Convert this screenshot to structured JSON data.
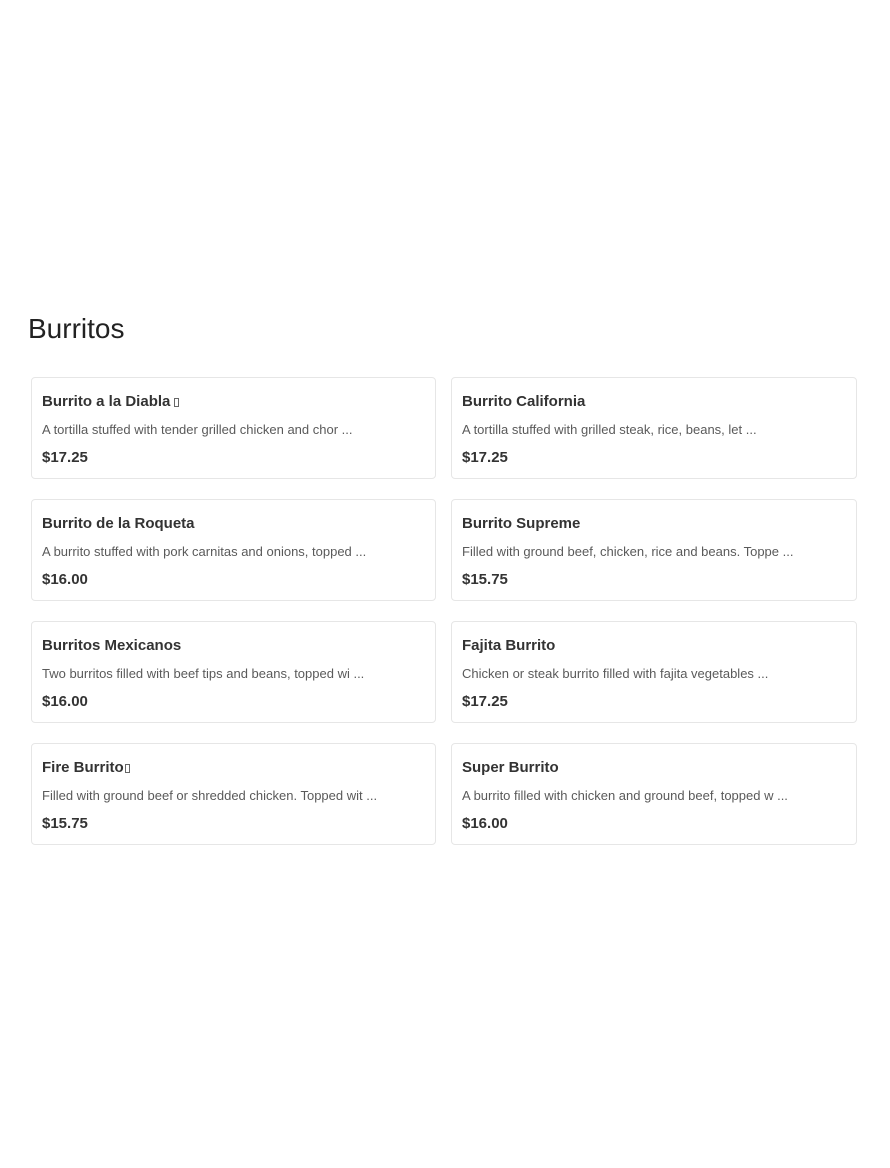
{
  "section": {
    "title": "Burritos"
  },
  "items": [
    {
      "name": "Burrito a la Diabla",
      "spicy": true,
      "description": "A tortilla stuffed with tender grilled chicken and chor ...",
      "price": "$17.25"
    },
    {
      "name": "Burrito California",
      "spicy": false,
      "description": "A tortilla stuffed with grilled steak, rice, beans, let ...",
      "price": "$17.25"
    },
    {
      "name": "Burrito de la Roqueta",
      "spicy": false,
      "description": "A burrito stuffed with pork carnitas and onions, topped ...",
      "price": "$16.00"
    },
    {
      "name": "Burrito Supreme",
      "spicy": false,
      "description": "Filled with ground beef, chicken, rice and beans. Toppe ...",
      "price": "$15.75"
    },
    {
      "name": "Burritos Mexicanos",
      "spicy": false,
      "description": "Two burritos filled with beef tips and beans, topped wi ...",
      "price": "$16.00"
    },
    {
      "name": "Fajita Burrito",
      "spicy": false,
      "description": "Chicken or steak burrito filled with fajita vegetables ...",
      "price": "$17.25"
    },
    {
      "name": "Fire Burrito",
      "spicy": true,
      "description": "Filled with ground beef or shredded chicken. Topped wit ...",
      "price": "$15.75"
    },
    {
      "name": "Super Burrito",
      "spicy": false,
      "description": "A burrito filled with chicken and ground beef, topped w ...",
      "price": "$16.00"
    }
  ]
}
